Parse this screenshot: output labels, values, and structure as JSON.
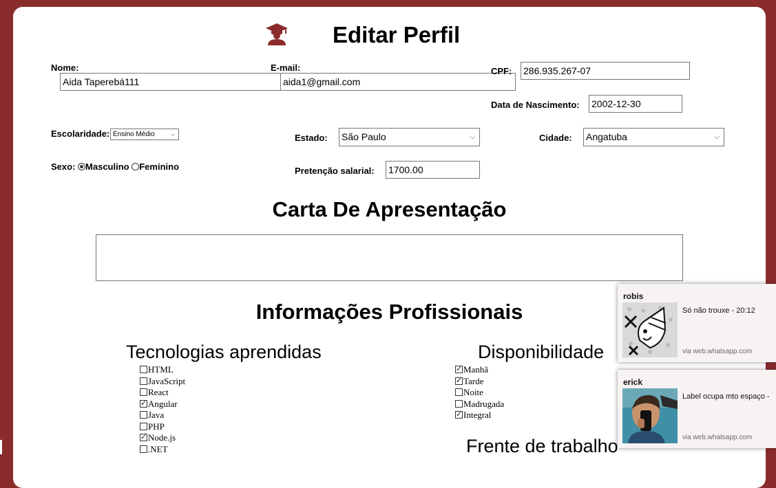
{
  "page": {
    "title": "Editar Perfil",
    "cap_icon": "graduation-cap-user-icon",
    "accent": "#8b2c2c"
  },
  "form": {
    "nome_label": "Nome:",
    "nome_value": "Aida Taperebá111",
    "email_label": "E-mail:",
    "email_value": "aida1@gmail.com",
    "cpf_label": "CPF:",
    "cpf_value": "286.935.267-07",
    "nascimento_label": "Data de Nascimento:",
    "nascimento_value": "2002-12-30",
    "escolaridade_label": "Escolaridade:",
    "escolaridade_value": "Ensino Médio",
    "estado_label": "Estado:",
    "estado_value": "São Paulo",
    "cidade_label": "Cidade:",
    "cidade_value": "Angatuba",
    "sexo_label": "Sexo:",
    "sexo_options": [
      "Masculino",
      "Feminino"
    ],
    "sexo_selected": "Masculino",
    "salario_label": "Pretenção salarial:",
    "salario_value": "1700.00"
  },
  "carta": {
    "title": "Carta De Apresentação",
    "value": ""
  },
  "profissional": {
    "title": "Informações Profissionais",
    "tecnologias_title": "Tecnologias aprendidas",
    "tecnologias": [
      {
        "label": "HTML",
        "checked": false
      },
      {
        "label": "JavaScript",
        "checked": false
      },
      {
        "label": "React",
        "checked": false
      },
      {
        "label": "Angular",
        "checked": true
      },
      {
        "label": "Java",
        "checked": false
      },
      {
        "label": "PHP",
        "checked": false
      },
      {
        "label": "Node.js",
        "checked": true
      },
      {
        "label": ".NET",
        "checked": false
      }
    ],
    "disponibilidade_title": "Disponibilidade",
    "disponibilidade": [
      {
        "label": "Manhã",
        "checked": true
      },
      {
        "label": "Tarde",
        "checked": true
      },
      {
        "label": "Noite",
        "checked": false
      },
      {
        "label": "Madrugada",
        "checked": false
      },
      {
        "label": "Integral",
        "checked": true
      }
    ],
    "frente_title": "Frente de trabalho"
  },
  "notifications": [
    {
      "sender": "robis",
      "message": "Só não trouxe - 20:12",
      "via": "via web.whatsapp.com",
      "avatar": "cartoon-sketch-avatar"
    },
    {
      "sender": "erick",
      "message": "Label ocupa mto espaço -",
      "via": "via web.whatsapp.com",
      "avatar": "selfie-photo-avatar"
    }
  ]
}
